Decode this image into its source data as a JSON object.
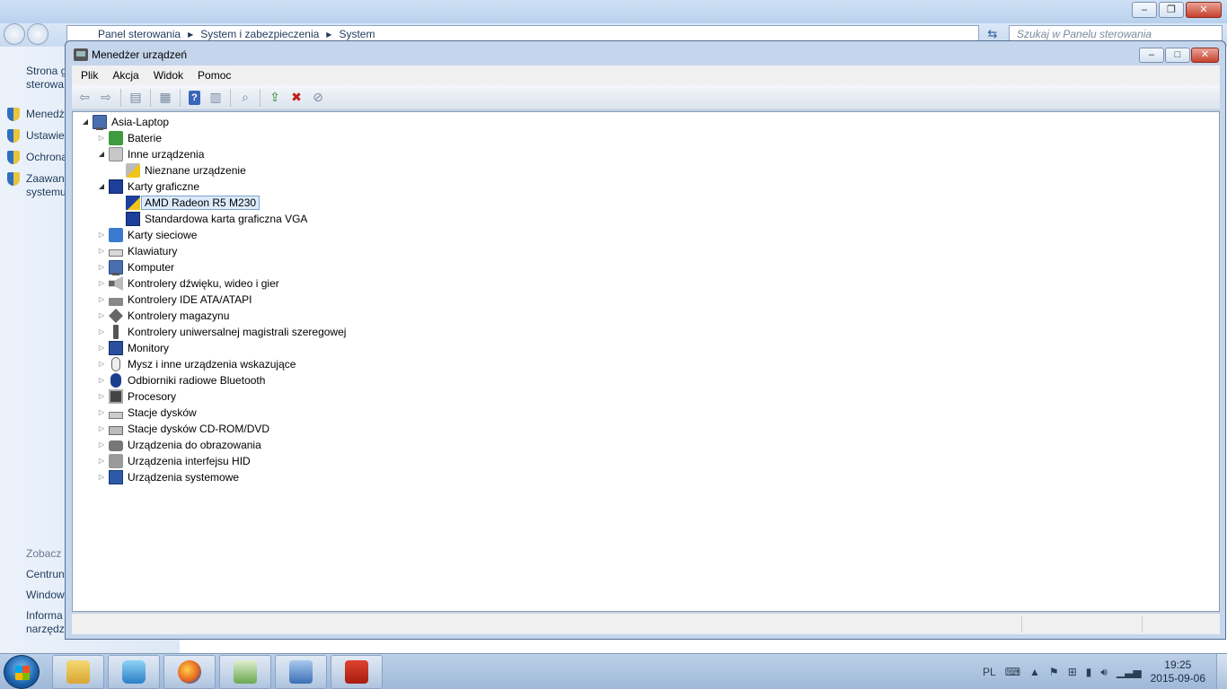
{
  "background_window": {
    "breadcrumbs": [
      "Panel sterowania",
      "System i zabezpieczenia",
      "System"
    ],
    "search_placeholder": "Szukaj w Panelu sterowania",
    "left_links": [
      {
        "label": "Strona g"
      },
      {
        "label": "sterowa"
      },
      {
        "label": "Menedż"
      },
      {
        "label": "Ustawie"
      },
      {
        "label": "Ochrona"
      },
      {
        "label": "Zaawan"
      },
      {
        "label": "systemu"
      }
    ],
    "see_also_label": "Zobacz",
    "see_also_links": [
      {
        "label": "Centrun"
      },
      {
        "label": "Window"
      },
      {
        "label": "Informa"
      },
      {
        "label": "narzędz"
      }
    ],
    "caption_buttons": {
      "minimize": "–",
      "restore": "❐",
      "close": "✕"
    }
  },
  "device_manager": {
    "title": "Menedżer urządzeń",
    "caption_buttons": {
      "minimize": "–",
      "maximize": "□",
      "close": "✕"
    },
    "menu": [
      "Plik",
      "Akcja",
      "Widok",
      "Pomoc"
    ],
    "toolbar": {
      "back": "⇦",
      "forward": "⇨",
      "show_hide": "▤",
      "properties": "▦",
      "help": "?",
      "view": "▥",
      "scan": "⌕",
      "update_driver": "⇪",
      "disable": "✖",
      "uninstall": "⊘"
    },
    "tree": {
      "root": "Asia-Laptop",
      "categories": [
        {
          "label": "Baterie",
          "icon": "battery-icon",
          "expanded": false
        },
        {
          "label": "Inne urządzenia",
          "icon": "unknown-device-icon",
          "expanded": true,
          "children": [
            {
              "label": "Nieznane urządzenie",
              "icon": "warning-device-icon",
              "selected": false
            }
          ]
        },
        {
          "label": "Karty graficzne",
          "icon": "display-adapter-icon",
          "expanded": true,
          "children": [
            {
              "label": "AMD Radeon R5 M230",
              "icon": "display-adapter-warning-icon",
              "selected": true
            },
            {
              "label": "Standardowa karta graficzna VGA",
              "icon": "display-adapter-icon",
              "selected": false
            }
          ]
        },
        {
          "label": "Karty sieciowe",
          "icon": "network-adapter-icon",
          "expanded": false
        },
        {
          "label": "Klawiatury",
          "icon": "keyboard-icon",
          "expanded": false
        },
        {
          "label": "Komputer",
          "icon": "computer-icon",
          "expanded": false
        },
        {
          "label": "Kontrolery dźwięku, wideo i gier",
          "icon": "audio-icon",
          "expanded": false
        },
        {
          "label": "Kontrolery IDE ATA/ATAPI",
          "icon": "ide-controller-icon",
          "expanded": false
        },
        {
          "label": "Kontrolery magazynu",
          "icon": "storage-controller-icon",
          "expanded": false
        },
        {
          "label": "Kontrolery uniwersalnej magistrali szeregowej",
          "icon": "usb-icon",
          "expanded": false
        },
        {
          "label": "Monitory",
          "icon": "monitor-icon",
          "expanded": false
        },
        {
          "label": "Mysz i inne urządzenia wskazujące",
          "icon": "mouse-icon",
          "expanded": false
        },
        {
          "label": "Odbiorniki radiowe Bluetooth",
          "icon": "bluetooth-icon",
          "expanded": false
        },
        {
          "label": "Procesory",
          "icon": "processor-icon",
          "expanded": false
        },
        {
          "label": "Stacje dysków",
          "icon": "disk-drive-icon",
          "expanded": false
        },
        {
          "label": "Stacje dysków CD-ROM/DVD",
          "icon": "cdrom-icon",
          "expanded": false
        },
        {
          "label": "Urządzenia do obrazowania",
          "icon": "imaging-icon",
          "expanded": false
        },
        {
          "label": "Urządzenia interfejsu HID",
          "icon": "hid-icon",
          "expanded": false
        },
        {
          "label": "Urządzenia systemowe",
          "icon": "system-device-icon",
          "expanded": false
        }
      ]
    }
  },
  "taskbar": {
    "apps": [
      {
        "name": "Eksplorator Windows",
        "icon": "explorer-icon"
      },
      {
        "name": "Windows Media Player",
        "icon": "media-player-icon"
      },
      {
        "name": "Firefox",
        "icon": "firefox-icon"
      },
      {
        "name": "Centrum sieci",
        "icon": "network-center-icon"
      },
      {
        "name": "Panel sterowania",
        "icon": "control-panel-icon"
      },
      {
        "name": "Menedżer urządzeń",
        "icon": "toolbox-icon"
      }
    ],
    "language": "PL",
    "clock_time": "19:25",
    "clock_date": "2015-09-06"
  }
}
